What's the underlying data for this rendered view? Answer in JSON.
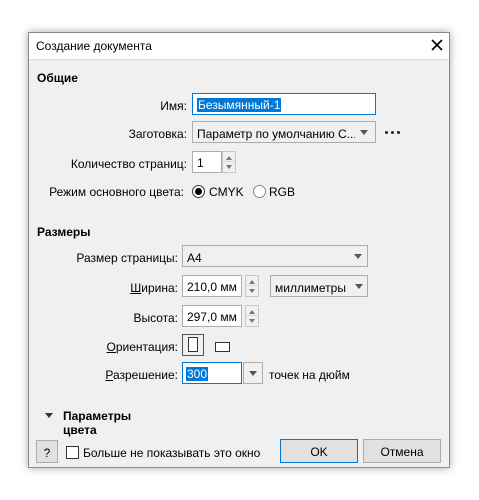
{
  "window": {
    "title": "Создание документа"
  },
  "general": {
    "heading": "Общие",
    "name_label": "Имя:",
    "name_value": "Безымянный-1",
    "preset_label": "Заготовка:",
    "preset_value": "Параметр по умолчанию С...",
    "pages_label": "Количество страниц:",
    "pages_value": "1",
    "color_mode_label": "Режим основного цвета:",
    "color_modes": [
      "CMYK",
      "RGB"
    ],
    "color_mode_selected": "CMYK"
  },
  "sizes": {
    "heading": "Размеры",
    "page_size_label": "Размер страницы:",
    "page_size_value": "A4",
    "width_label": "Ширина:",
    "width_value": "210,0 мм",
    "units_value": "миллиметры",
    "height_label": "Высота:",
    "height_value": "297,0 мм",
    "orientation_label": "Ориентация:",
    "resolution_label": "Разрешение:",
    "resolution_value": "300",
    "resolution_unit": "точек на дюйм"
  },
  "color_settings": {
    "heading": "Параметры цвета"
  },
  "footer": {
    "help_label": "?",
    "dont_show_label": "Больше не показывать это окно",
    "ok_label": "OK",
    "cancel_label": "Отмена"
  }
}
